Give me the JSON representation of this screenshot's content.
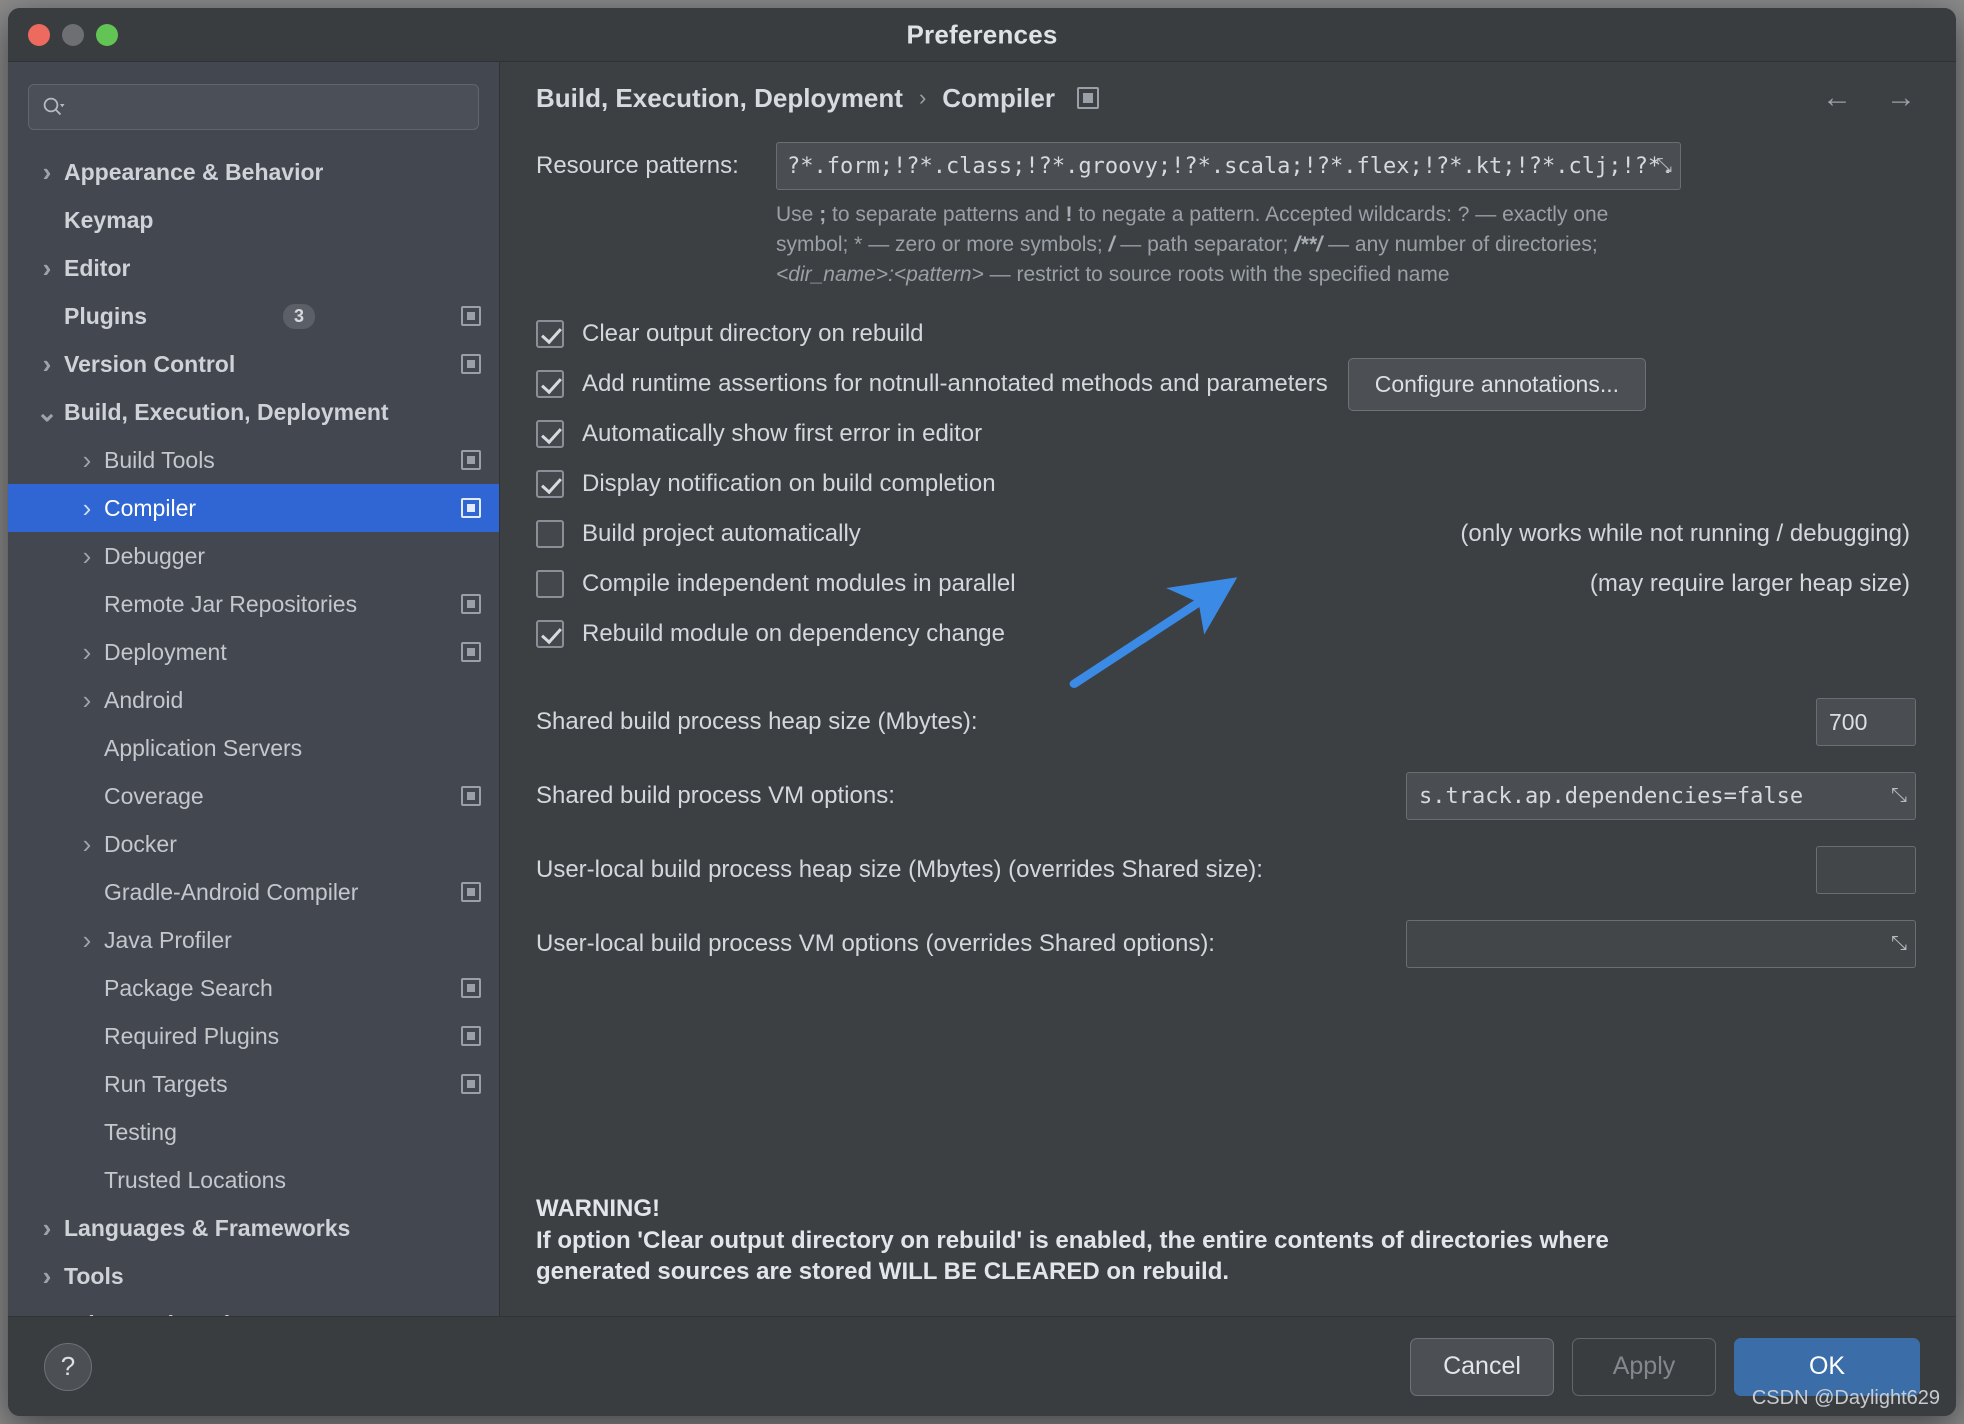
{
  "window": {
    "title": "Preferences",
    "traffic_lights": [
      "close",
      "minimize",
      "zoom"
    ]
  },
  "search": {
    "value": "",
    "placeholder": ""
  },
  "sidebar": {
    "items": [
      {
        "label": "Appearance & Behavior",
        "level": 0,
        "chevron": "right",
        "bold": true,
        "selected": false,
        "badge": null,
        "mark": false
      },
      {
        "label": "Keymap",
        "level": 0,
        "chevron": "none",
        "bold": true,
        "selected": false,
        "badge": null,
        "mark": false
      },
      {
        "label": "Editor",
        "level": 0,
        "chevron": "right",
        "bold": true,
        "selected": false,
        "badge": null,
        "mark": false
      },
      {
        "label": "Plugins",
        "level": 0,
        "chevron": "none",
        "bold": true,
        "selected": false,
        "badge": "3",
        "mark": true
      },
      {
        "label": "Version Control",
        "level": 0,
        "chevron": "right",
        "bold": true,
        "selected": false,
        "badge": null,
        "mark": true
      },
      {
        "label": "Build, Execution, Deployment",
        "level": 0,
        "chevron": "down",
        "bold": true,
        "selected": false,
        "badge": null,
        "mark": false
      },
      {
        "label": "Build Tools",
        "level": 1,
        "chevron": "right",
        "bold": false,
        "selected": false,
        "badge": null,
        "mark": true
      },
      {
        "label": "Compiler",
        "level": 1,
        "chevron": "right",
        "bold": false,
        "selected": true,
        "badge": null,
        "mark": true
      },
      {
        "label": "Debugger",
        "level": 1,
        "chevron": "right",
        "bold": false,
        "selected": false,
        "badge": null,
        "mark": false
      },
      {
        "label": "Remote Jar Repositories",
        "level": 1,
        "chevron": "none",
        "bold": false,
        "selected": false,
        "badge": null,
        "mark": true
      },
      {
        "label": "Deployment",
        "level": 1,
        "chevron": "right",
        "bold": false,
        "selected": false,
        "badge": null,
        "mark": true
      },
      {
        "label": "Android",
        "level": 1,
        "chevron": "right",
        "bold": false,
        "selected": false,
        "badge": null,
        "mark": false
      },
      {
        "label": "Application Servers",
        "level": 1,
        "chevron": "none",
        "bold": false,
        "selected": false,
        "badge": null,
        "mark": false
      },
      {
        "label": "Coverage",
        "level": 1,
        "chevron": "none",
        "bold": false,
        "selected": false,
        "badge": null,
        "mark": true
      },
      {
        "label": "Docker",
        "level": 1,
        "chevron": "right",
        "bold": false,
        "selected": false,
        "badge": null,
        "mark": false
      },
      {
        "label": "Gradle-Android Compiler",
        "level": 1,
        "chevron": "none",
        "bold": false,
        "selected": false,
        "badge": null,
        "mark": true
      },
      {
        "label": "Java Profiler",
        "level": 1,
        "chevron": "right",
        "bold": false,
        "selected": false,
        "badge": null,
        "mark": false
      },
      {
        "label": "Package Search",
        "level": 1,
        "chevron": "none",
        "bold": false,
        "selected": false,
        "badge": null,
        "mark": true
      },
      {
        "label": "Required Plugins",
        "level": 1,
        "chevron": "none",
        "bold": false,
        "selected": false,
        "badge": null,
        "mark": true
      },
      {
        "label": "Run Targets",
        "level": 1,
        "chevron": "none",
        "bold": false,
        "selected": false,
        "badge": null,
        "mark": true
      },
      {
        "label": "Testing",
        "level": 1,
        "chevron": "none",
        "bold": false,
        "selected": false,
        "badge": null,
        "mark": false
      },
      {
        "label": "Trusted Locations",
        "level": 1,
        "chevron": "none",
        "bold": false,
        "selected": false,
        "badge": null,
        "mark": false
      },
      {
        "label": "Languages & Frameworks",
        "level": 0,
        "chevron": "right",
        "bold": true,
        "selected": false,
        "badge": null,
        "mark": false
      },
      {
        "label": "Tools",
        "level": 0,
        "chevron": "right",
        "bold": true,
        "selected": false,
        "badge": null,
        "mark": false
      },
      {
        "label": "Advanced Settings",
        "level": 0,
        "chevron": "none",
        "bold": true,
        "selected": false,
        "badge": null,
        "mark": false
      }
    ]
  },
  "breadcrumb": {
    "parent": "Build, Execution, Deployment",
    "separator": "›",
    "current": "Compiler",
    "back_arrow": "←",
    "forward_arrow": "→"
  },
  "main": {
    "resource_patterns": {
      "label": "Resource patterns:",
      "value": "?*.form;!?*.class;!?*.groovy;!?*.scala;!?*.flex;!?*.kt;!?*.clj;!?*.aj",
      "expand_icon": "⤡"
    },
    "hint_line1_a": "Use ",
    "hint_semicolon": ";",
    "hint_line1_b": " to separate patterns and ",
    "hint_bang": "!",
    "hint_line1_c": " to negate a pattern. Accepted wildcards: ? — exactly one symbol; * — zero or",
    "hint_line2_a": "more symbols; ",
    "hint_slash": "/",
    "hint_line2_b": " — path separator; ",
    "hint_globstar": "/**/",
    "hint_line2_c": " — any number of directories; ",
    "hint_dirname": "<dir_name>:<pattern>",
    "hint_line2_d": " — restrict to",
    "hint_line3": "source roots with the specified name",
    "checkboxes": [
      {
        "label": "Clear output directory on rebuild",
        "checked": true,
        "note": "",
        "button": ""
      },
      {
        "label": "Add runtime assertions for notnull-annotated methods and parameters",
        "checked": true,
        "note": "",
        "button": "Configure annotations..."
      },
      {
        "label": "Automatically show first error in editor",
        "checked": true,
        "note": "",
        "button": ""
      },
      {
        "label": "Display notification on build completion",
        "checked": true,
        "note": "",
        "button": ""
      },
      {
        "label": "Build project automatically",
        "checked": false,
        "note": "(only works while not running / debugging)",
        "button": ""
      },
      {
        "label": "Compile independent modules in parallel",
        "checked": false,
        "note": "(may require larger heap size)",
        "button": ""
      },
      {
        "label": "Rebuild module on dependency change",
        "checked": true,
        "note": "",
        "button": ""
      }
    ],
    "fields": [
      {
        "label": "Shared build process heap size (Mbytes):",
        "value": "700",
        "kind": "small",
        "expandable": false
      },
      {
        "label": "Shared build process VM options:",
        "value": "s.track.ap.dependencies=false",
        "kind": "wide",
        "expandable": true
      },
      {
        "label": "User-local build process heap size (Mbytes) (overrides Shared size):",
        "value": "",
        "kind": "small",
        "expandable": false
      },
      {
        "label": "User-local build process VM options (overrides Shared options):",
        "value": "",
        "kind": "wide",
        "expandable": true
      }
    ],
    "warning": {
      "title": "WARNING!",
      "line1": "If option 'Clear output directory on rebuild' is enabled, the entire contents of directories where",
      "line2": "generated sources are stored WILL BE CLEARED on rebuild."
    },
    "annotation_arrow_color": "#3b8ae6"
  },
  "footer": {
    "help_label": "?",
    "cancel_label": "Cancel",
    "apply_label": "Apply",
    "ok_label": "OK",
    "watermark": "CSDN @Daylight629"
  },
  "colors": {
    "accent_selected": "#2f66d4",
    "ok_button": "#3b6ea8",
    "arrow": "#3b8ae6"
  }
}
